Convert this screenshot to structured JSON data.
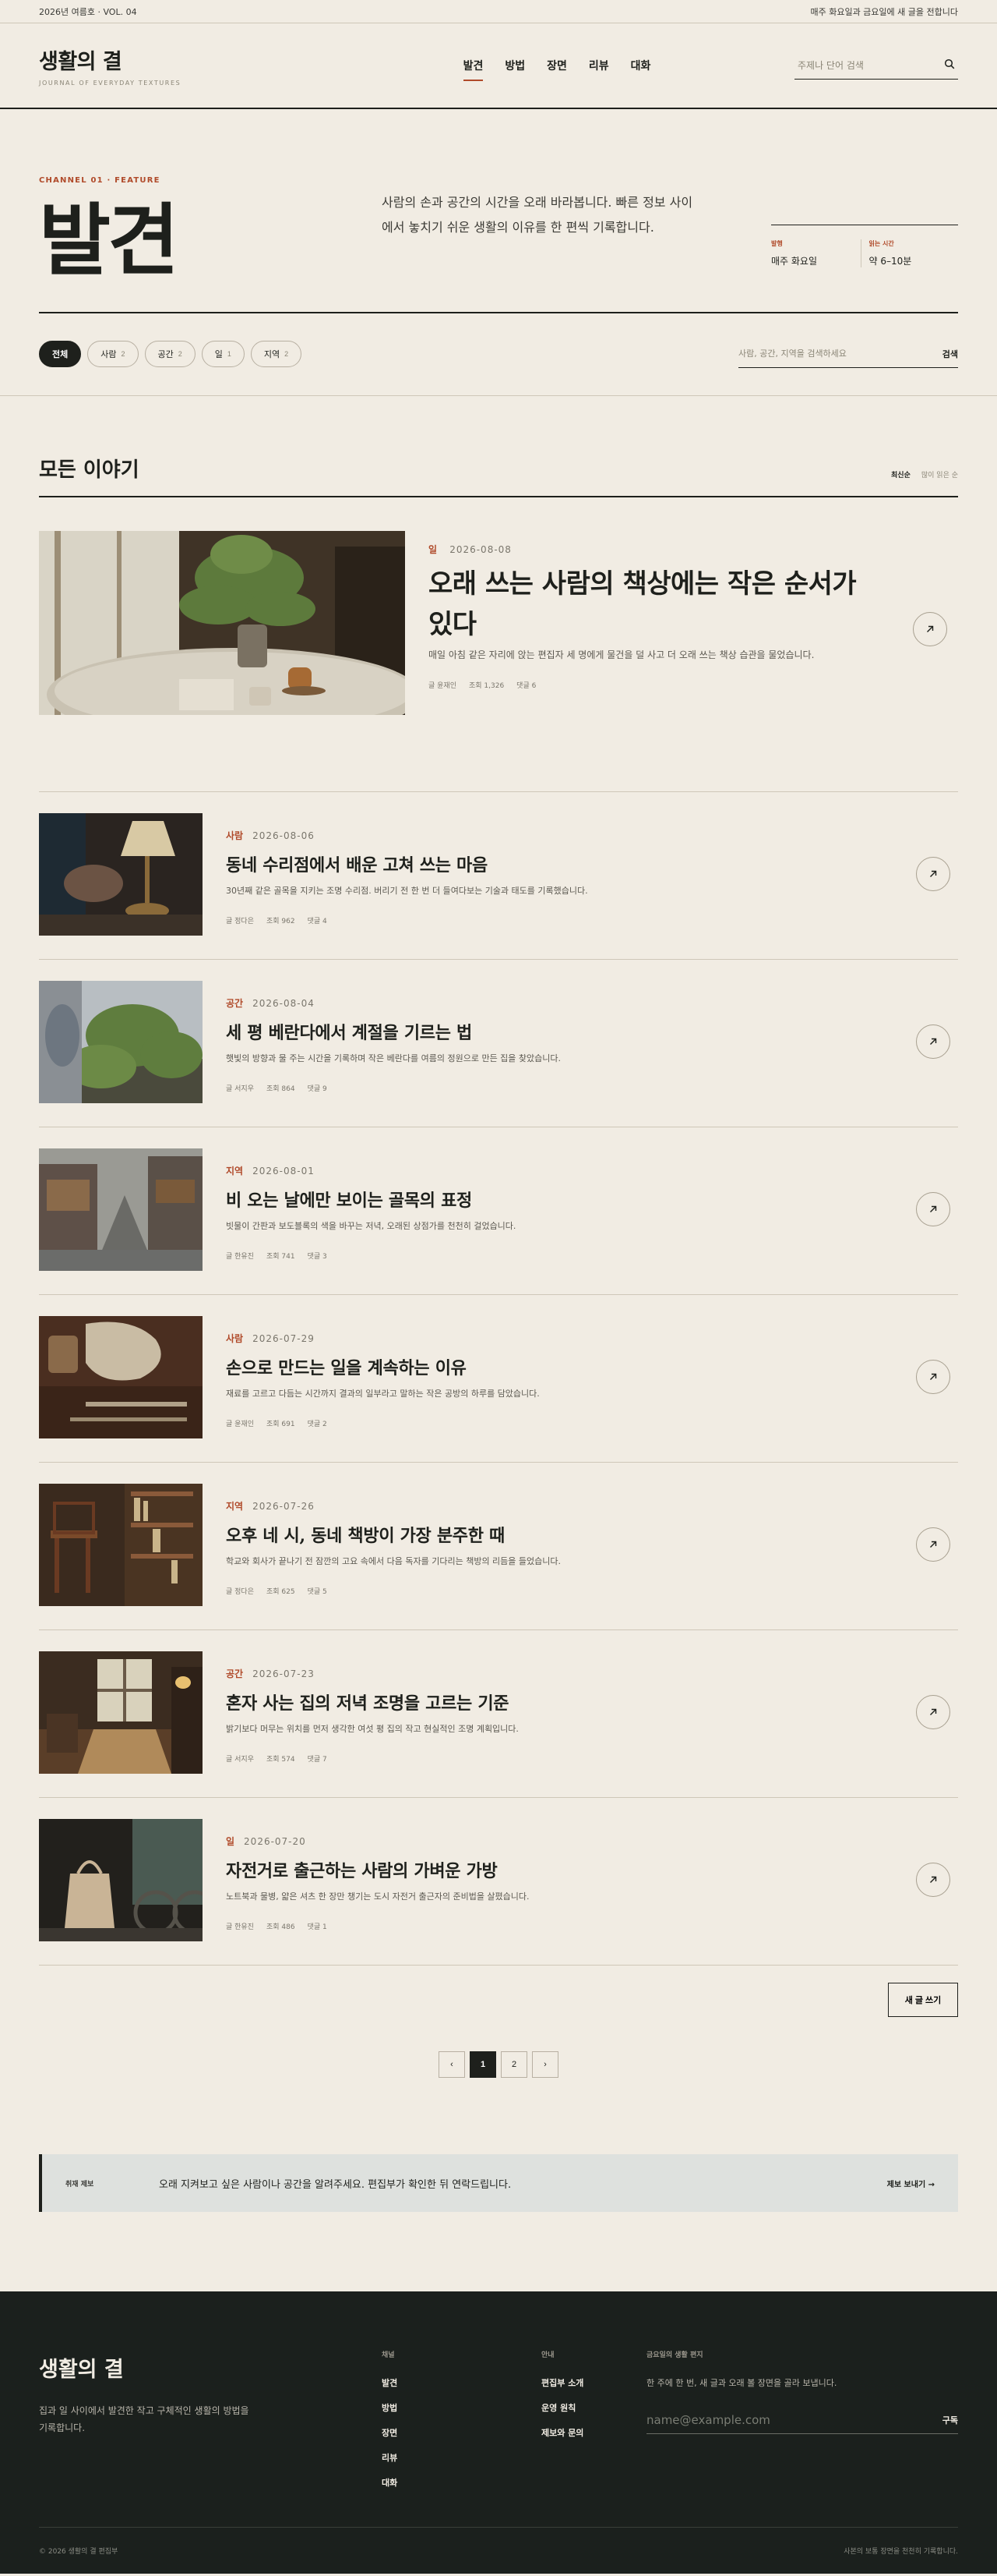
{
  "topbar": {
    "issue": "2026년 여름호 · VOL. 04",
    "notice": "매주 화요일과 금요일에 새 글을 전합니다"
  },
  "header": {
    "brand": "생활의 결",
    "brand_sub": "JOURNAL OF EVERYDAY TEXTURES",
    "nav": [
      "발견",
      "방법",
      "장면",
      "리뷰",
      "대화"
    ],
    "search_placeholder": "주제나 단어 검색"
  },
  "hero": {
    "channel": "CHANNEL 01 · FEATURE",
    "title": "발견",
    "description": "사람의 손과 공간의 시간을 오래 바라봅니다. 빠른 정보 사이에서 놓치기 쉬운 생활의 이유를 한 편씩 기록합니다.",
    "meta": [
      {
        "label": "발행",
        "value": "매주 화요일"
      },
      {
        "label": "읽는 시간",
        "value": "약 6–10분"
      }
    ]
  },
  "filters": {
    "chips": [
      {
        "label": "전체",
        "count": ""
      },
      {
        "label": "사람",
        "count": "2"
      },
      {
        "label": "공간",
        "count": "2"
      },
      {
        "label": "일",
        "count": "1"
      },
      {
        "label": "지역",
        "count": "2"
      }
    ],
    "search_placeholder": "사람, 공간, 지역을 검색하세요",
    "search_button": "검색"
  },
  "section": {
    "title": "모든 이야기",
    "sort_active": "최신순",
    "sort_other": "많이 읽은 순"
  },
  "featured": {
    "category": "일",
    "date": "2026-08-08",
    "title": "오래 쓰는 사람의 책상에는 작은 순서가 있다",
    "excerpt": "매일 아침 같은 자리에 앉는 편집자 세 명에게 물건을 덜 사고 더 오래 쓰는 책상 습관을 물었습니다.",
    "author": "글 윤재인",
    "views": "조회 1,326",
    "comments": "댓글 6"
  },
  "articles": [
    {
      "category": "사람",
      "date": "2026-08-06",
      "title": "동네 수리점에서 배운 고쳐 쓰는 마음",
      "excerpt": "30년째 같은 골목을 지키는 조명 수리점. 버리기 전 한 번 더 들여다보는 기술과 태도를 기록했습니다.",
      "author": "글 정다은",
      "views": "조회 962",
      "comments": "댓글 4"
    },
    {
      "category": "공간",
      "date": "2026-08-04",
      "title": "세 평 베란다에서 계절을 기르는 법",
      "excerpt": "햇빛의 방향과 물 주는 시간을 기록하며 작은 베란다를 여름의 정원으로 만든 집을 찾았습니다.",
      "author": "글 서지우",
      "views": "조회 864",
      "comments": "댓글 9"
    },
    {
      "category": "지역",
      "date": "2026-08-01",
      "title": "비 오는 날에만 보이는 골목의 표정",
      "excerpt": "빗물이 간판과 보도블록의 색을 바꾸는 저녁, 오래된 상점가를 천천히 걸었습니다.",
      "author": "글 한유진",
      "views": "조회 741",
      "comments": "댓글 3"
    },
    {
      "category": "사람",
      "date": "2026-07-29",
      "title": "손으로 만드는 일을 계속하는 이유",
      "excerpt": "재료를 고르고 다듬는 시간까지 결과의 일부라고 말하는 작은 공방의 하루를 담았습니다.",
      "author": "글 윤재인",
      "views": "조회 691",
      "comments": "댓글 2"
    },
    {
      "category": "지역",
      "date": "2026-07-26",
      "title": "오후 네 시, 동네 책방이 가장 분주한 때",
      "excerpt": "학교와 회사가 끝나기 전 잠깐의 고요 속에서 다음 독자를 기다리는 책방의 리듬을 들었습니다.",
      "author": "글 정다은",
      "views": "조회 625",
      "comments": "댓글 5"
    },
    {
      "category": "공간",
      "date": "2026-07-23",
      "title": "혼자 사는 집의 저녁 조명을 고르는 기준",
      "excerpt": "밝기보다 머무는 위치를 먼저 생각한 여섯 평 집의 작고 현실적인 조명 계획입니다.",
      "author": "글 서지우",
      "views": "조회 574",
      "comments": "댓글 7"
    },
    {
      "category": "일",
      "date": "2026-07-20",
      "title": "자전거로 출근하는 사람의 가벼운 가방",
      "excerpt": "노트북과 물병, 얇은 셔츠 한 장만 챙기는 도시 자전거 출근자의 준비법을 살폈습니다.",
      "author": "글 한유진",
      "views": "조회 486",
      "comments": "댓글 1"
    }
  ],
  "actions": {
    "new_post": "새 글 쓰기"
  },
  "pagination": {
    "prev": "‹",
    "pages": [
      "1",
      "2"
    ],
    "next": "›",
    "current": "1"
  },
  "tip": {
    "label": "취재 제보",
    "text": "오래 지켜보고 싶은 사람이나 공간을 알려주세요. 편집부가 확인한 뒤 연락드립니다.",
    "link": "제보 보내기 →"
  },
  "footer": {
    "brand": "생활의 결",
    "description": "집과 일 사이에서 발견한 작고 구체적인 생활의 방법을 기록합니다.",
    "col1": {
      "title": "채널",
      "links": [
        "발견",
        "방법",
        "장면",
        "리뷰",
        "대화"
      ]
    },
    "col2": {
      "title": "안내",
      "links": [
        "편집부 소개",
        "운영 원칙",
        "제보와 문의"
      ]
    },
    "newsletter": {
      "title": "금요일의 생활 편지",
      "text": "한 주에 한 번, 새 글과 오래 볼 장면을 골라 보냅니다.",
      "placeholder": "name@example.com",
      "button": "구독"
    },
    "copyright": "© 2026 생활의 결 편집부",
    "note": "사본의 보통 장면을 천천히 기록합니다."
  },
  "colors": {
    "background": "#f1ece3",
    "ink": "#1e201c",
    "accent": "#b04a2a",
    "footer_bg": "#1b201d",
    "tip_bg": "#dee1de"
  },
  "icons": {
    "search": "search-icon",
    "arrow": "arrow-up-right-icon"
  }
}
